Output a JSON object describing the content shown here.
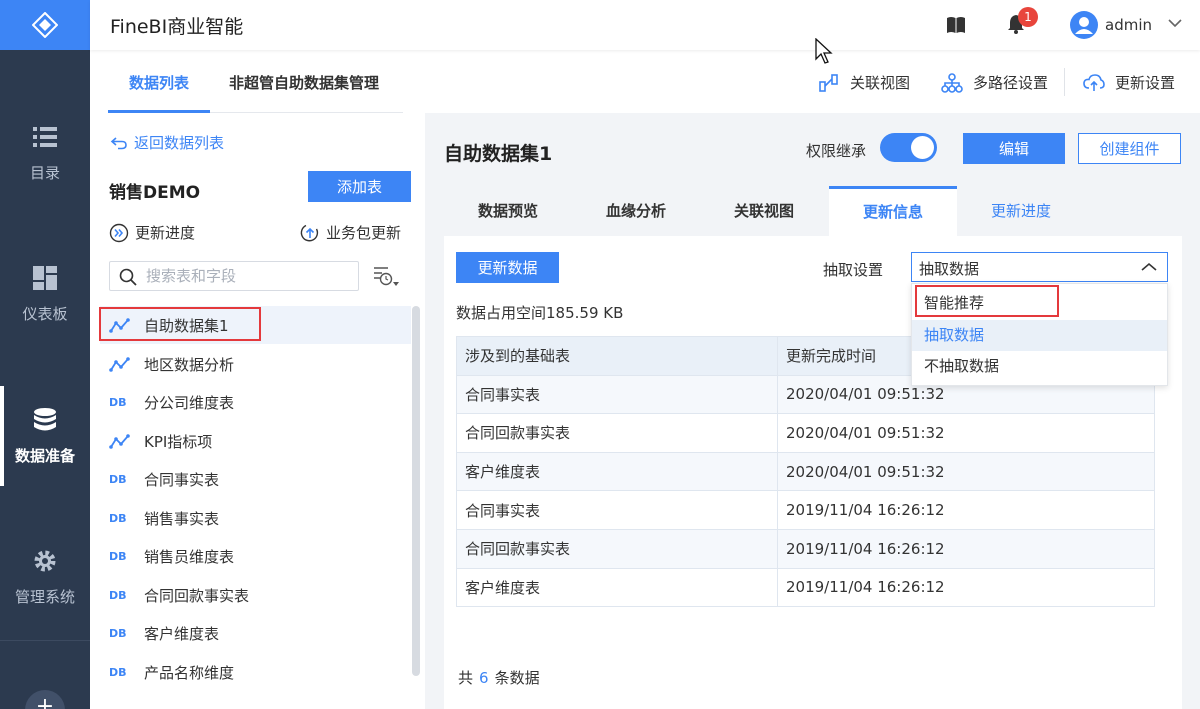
{
  "app": {
    "title": "FineBI商业智能",
    "username": "admin",
    "notification_count": "1"
  },
  "nav": {
    "items": [
      {
        "label": "目录",
        "icon": "list-icon"
      },
      {
        "label": "仪表板",
        "icon": "dashboard-icon"
      },
      {
        "label": "数据准备",
        "icon": "database-icon",
        "active": true
      },
      {
        "label": "管理系统",
        "icon": "gear-icon"
      }
    ],
    "plus_label": "+"
  },
  "top_tabs": {
    "data_list": "数据列表",
    "manage": "非超管自助数据集管理"
  },
  "toolbar": {
    "relation_view": "关联视图",
    "multipath": "多路径设置",
    "update_settings": "更新设置"
  },
  "left_panel": {
    "back_link": "返回数据列表",
    "package_title": "销售DEMO",
    "add_table": "添加表",
    "update_progress": "更新进度",
    "package_update": "业务包更新",
    "search_placeholder": "搜索表和字段",
    "db_badge": "DB",
    "tables": [
      {
        "name": "自助数据集1",
        "type": "self-service"
      },
      {
        "name": "地区数据分析",
        "type": "self-service"
      },
      {
        "name": "分公司维度表",
        "type": "db"
      },
      {
        "name": "KPI指标项",
        "type": "self-service"
      },
      {
        "name": "合同事实表",
        "type": "db"
      },
      {
        "name": "销售事实表",
        "type": "db"
      },
      {
        "name": "销售员维度表",
        "type": "db"
      },
      {
        "name": "合同回款事实表",
        "type": "db"
      },
      {
        "name": "客户维度表",
        "type": "db"
      },
      {
        "name": "产品名称维度",
        "type": "db"
      }
    ]
  },
  "main": {
    "title": "自助数据集1",
    "permission_label": "权限继承",
    "permission_on": true,
    "edit_button": "编辑",
    "create_component_button": "创建组件",
    "subtabs": [
      "数据预览",
      "血缘分析",
      "关联视图",
      "更新信息",
      "更新进度"
    ],
    "refresh_button": "更新数据",
    "extract_label": "抽取设置",
    "extract_value": "抽取数据",
    "extract_options": [
      "智能推荐",
      "抽取数据",
      "不抽取数据"
    ],
    "space_used": "数据占用空间185.59 KB",
    "table_headers": [
      "涉及到的基础表",
      "更新完成时间"
    ],
    "table_rows": [
      [
        "合同事实表",
        "2020/04/01 09:51:32"
      ],
      [
        "合同回款事实表",
        "2020/04/01 09:51:32"
      ],
      [
        "客户维度表",
        "2020/04/01 09:51:32"
      ],
      [
        "合同事实表",
        "2019/11/04 16:26:12"
      ],
      [
        "合同回款事实表",
        "2019/11/04 16:26:12"
      ],
      [
        "客户维度表",
        "2019/11/04 16:26:12"
      ]
    ],
    "footer_prefix": "共",
    "footer_count": "6",
    "footer_suffix": "条数据"
  },
  "colors": {
    "accent": "#3d85f5",
    "nav_bg": "#2c3a4f",
    "highlight": "#e4393c"
  }
}
